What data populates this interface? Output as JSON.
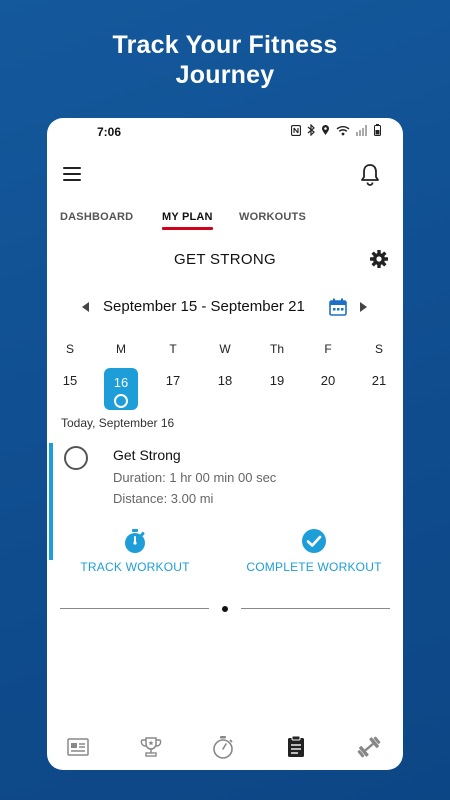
{
  "headline": {
    "line1": "Track Your Fitness",
    "line2": "Journey"
  },
  "status_bar": {
    "time": "7:06",
    "icons": [
      "nfc-icon",
      "bluetooth-icon",
      "location-icon",
      "wifi-icon",
      "signal-icon",
      "battery-icon"
    ]
  },
  "app_bar": {
    "menu_icon": "hamburger-menu-icon",
    "notification_icon": "bell-icon"
  },
  "tabs": [
    {
      "label": "DASHBOARD",
      "active": false
    },
    {
      "label": "MY PLAN",
      "active": true
    },
    {
      "label": "WORKOUTS",
      "active": false
    }
  ],
  "plan": {
    "title": "GET STRONG",
    "settings_icon": "gear-icon"
  },
  "week": {
    "range": "September 15 - September 21",
    "days": [
      {
        "letter": "S",
        "num": "15",
        "selected": false
      },
      {
        "letter": "M",
        "num": "16",
        "selected": true
      },
      {
        "letter": "T",
        "num": "17",
        "selected": false
      },
      {
        "letter": "W",
        "num": "18",
        "selected": false
      },
      {
        "letter": "Th",
        "num": "19",
        "selected": false
      },
      {
        "letter": "F",
        "num": "20",
        "selected": false
      },
      {
        "letter": "S",
        "num": "21",
        "selected": false
      }
    ]
  },
  "today_label": "Today, September 16",
  "workout": {
    "name": "Get Strong",
    "duration": "Duration: 1 hr 00 min 00 sec",
    "distance": "Distance: 3.00 mi"
  },
  "actions": {
    "track_label": "TRACK WORKOUT",
    "complete_label": "COMPLETE WORKOUT"
  },
  "pager": {
    "pages": 1,
    "current": 1
  },
  "bottom_nav": [
    "news-feed-icon",
    "trophy-icon",
    "stopwatch-icon",
    "clipboard-icon",
    "dumbbell-icon"
  ],
  "colors": {
    "accent": "#1e9ed8",
    "tab_underline": "#d0021b",
    "background": "#12549a"
  }
}
